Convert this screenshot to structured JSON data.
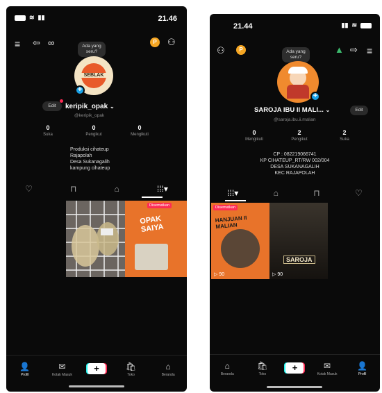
{
  "left": {
    "status": {
      "time": "21.46"
    },
    "header": {
      "badge": "P",
      "tooltip": "Ada yang seru?"
    },
    "avatar_text": "SEBLAK",
    "profile": {
      "username": "keripik_opak",
      "handle": "@keripik_opak",
      "edit": "Edit"
    },
    "stats": [
      {
        "value": "0",
        "label": "Suka"
      },
      {
        "value": "0",
        "label": "Pengikut"
      },
      {
        "value": "0",
        "label": "Mengikuti"
      }
    ],
    "bio": [
      "Produksi cihateup",
      "Rajapolah",
      "Desa Sukanagalih",
      "kampung cihateup"
    ],
    "video2": {
      "tag": "Disematkan",
      "title": "OPAK SAIYA"
    },
    "nav": [
      {
        "label": "Profil",
        "icon": "👤"
      },
      {
        "label": "Kotak Masuk",
        "icon": "✉"
      },
      {
        "label": "",
        "icon": "+"
      },
      {
        "label": "Toko",
        "icon": "🛍"
      },
      {
        "label": "Beranda",
        "icon": "⌂"
      }
    ]
  },
  "right": {
    "status": {
      "time": "21.44"
    },
    "header": {
      "badge": "P",
      "tooltip": "Ada yang seru?"
    },
    "profile": {
      "username": "SAROJA IBU II MALI...",
      "handle": "@saroja.ibu.ii.malian",
      "edit": "Edit"
    },
    "stats": [
      {
        "value": "0",
        "label": "Mengikuti"
      },
      {
        "value": "2",
        "label": "Pengikut"
      },
      {
        "value": "2",
        "label": "Suka"
      }
    ],
    "bio": [
      "CP : 082219066741",
      "KP CIHATEUP_RT/RW 002/004",
      "DESA SUKANAGALIH",
      "KEC RAJAPOLAH"
    ],
    "videos": [
      {
        "tag": "Disematkan",
        "title": "HANJUAN II MALIAN",
        "views": "90"
      },
      {
        "title": "SAROJA",
        "views": "90"
      }
    ],
    "nav": [
      {
        "label": "Beranda",
        "icon": "⌂"
      },
      {
        "label": "Toko",
        "icon": "🛍"
      },
      {
        "label": "",
        "icon": "+"
      },
      {
        "label": "Kotak Masuk",
        "icon": "✉"
      },
      {
        "label": "Profil",
        "icon": "👤"
      }
    ]
  },
  "colors": {
    "accent_blue": "#1aa3e8",
    "badge_orange": "#f5a623",
    "pin_red": "#fe2c55",
    "orange_thumb": "#e8732a"
  }
}
